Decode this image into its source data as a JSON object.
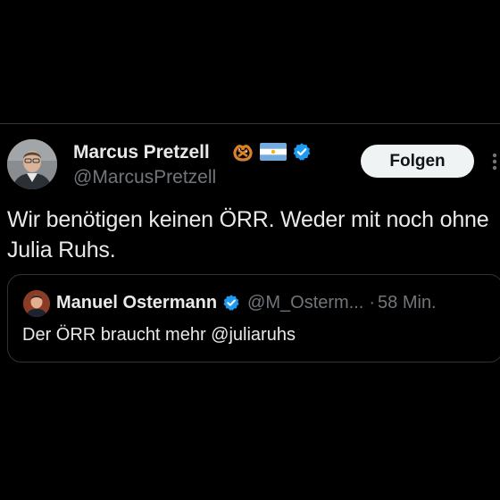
{
  "tweet": {
    "author": {
      "name": "Marcus Pretzell",
      "handle": "@MarcusPretzell",
      "badges": [
        "pretzel-emoji",
        "argentina-flag-emoji",
        "verified-badge-icon"
      ]
    },
    "follow_label": "Folgen",
    "more_icon": "more-vertical-icon",
    "text": "Wir benötigen keinen ÖRR. Weder mit noch ohne Julia Ruhs.",
    "quote": {
      "name": "Manuel Ostermann",
      "handle": "@M_Osterm...",
      "separator": "·",
      "time": "58 Min.",
      "text": "Der ÖRR braucht mehr @juliaruhs"
    }
  },
  "colors": {
    "background": "#000000",
    "text": "#e7e9ea",
    "secondary_text": "#71767b",
    "verified_blue": "#1d9bf0",
    "follow_button_bg": "#eff3f4",
    "border": "#2f3336"
  }
}
